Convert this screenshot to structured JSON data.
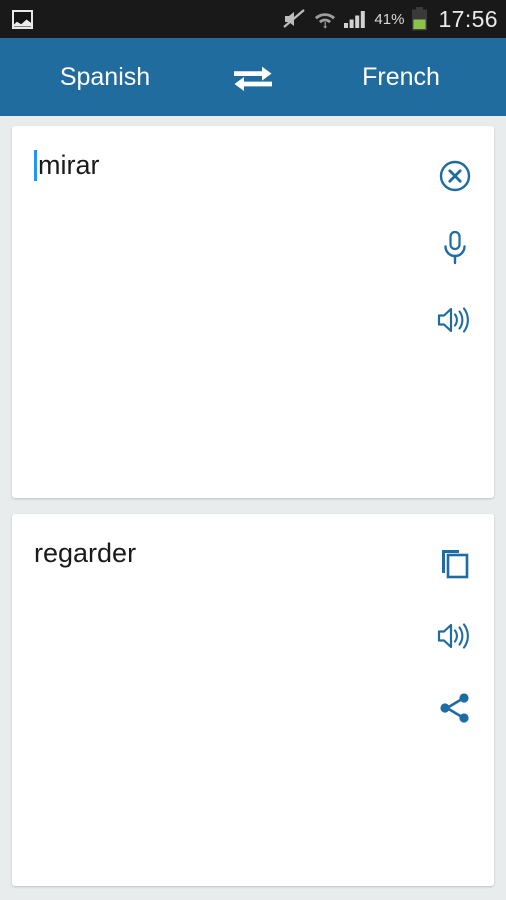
{
  "status_bar": {
    "notification_icon": "gallery-image-icon",
    "mute_icon": "volume-muted-icon",
    "wifi_icon": "wifi-transfer-icon",
    "signal_icon": "cellular-signal-icon",
    "battery_percent": "41%",
    "battery_icon": "battery-icon",
    "clock": "17:56",
    "background_color": "#191919"
  },
  "language_bar": {
    "source_language": "Spanish",
    "target_language": "French",
    "swap_icon": "swap-horizontal-icon",
    "background_color": "#206c9f",
    "text_color": "#ffffff"
  },
  "input_card": {
    "text": "mirar",
    "caret_color": "#2196f3",
    "actions": [
      {
        "name": "clear-button",
        "icon": "close-circle-icon"
      },
      {
        "name": "voice-input-button",
        "icon": "microphone-icon"
      },
      {
        "name": "speak-source-button",
        "icon": "speaker-icon"
      }
    ]
  },
  "output_card": {
    "text": "regarder",
    "actions": [
      {
        "name": "copy-button",
        "icon": "copy-icon"
      },
      {
        "name": "speak-translation-button",
        "icon": "speaker-icon"
      },
      {
        "name": "share-button",
        "icon": "share-icon"
      }
    ]
  },
  "theme": {
    "accent_color": "#206c9f",
    "icon_color": "#1f6ca3",
    "page_background": "#e8ecec",
    "card_background": "#ffffff"
  }
}
